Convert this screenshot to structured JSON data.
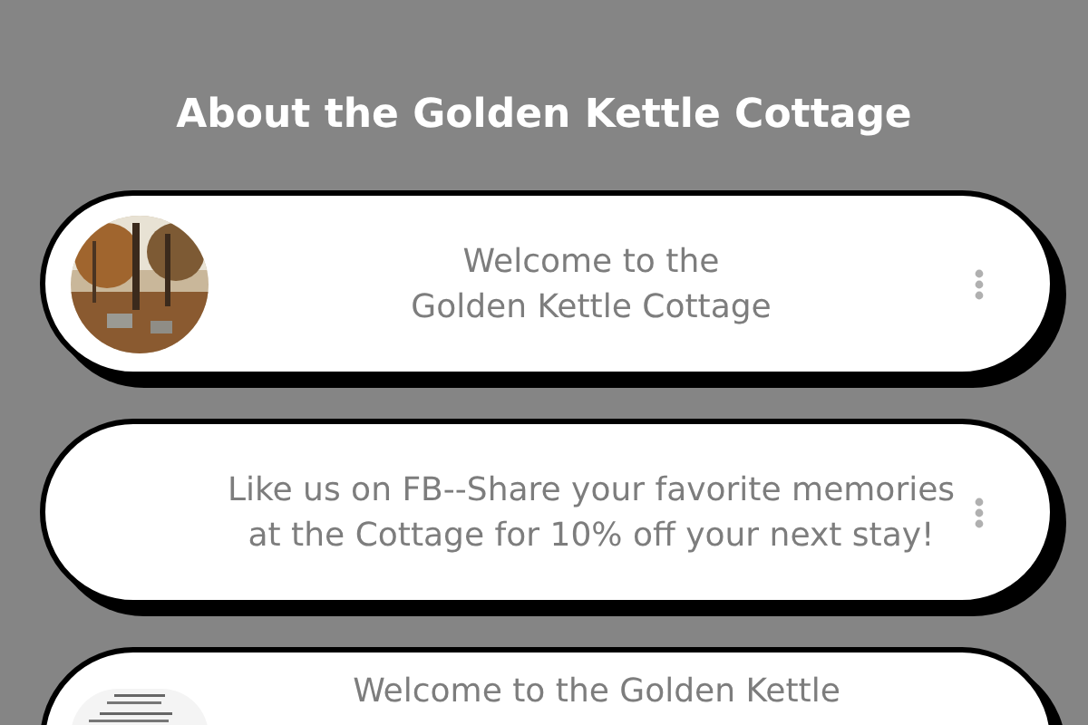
{
  "title": "About the Golden Kettle Cottage",
  "links": [
    {
      "lines": [
        "Welcome to the",
        "Golden Kettle Cottage"
      ]
    },
    {
      "kind": "plain",
      "lines": [
        "Like us on FB--Share your favorite memories",
        "at the Cottage for 10% off your next stay!"
      ]
    },
    {
      "kind": "document",
      "lines": [
        "Welcome to the Golden Kettle"
      ]
    }
  ]
}
